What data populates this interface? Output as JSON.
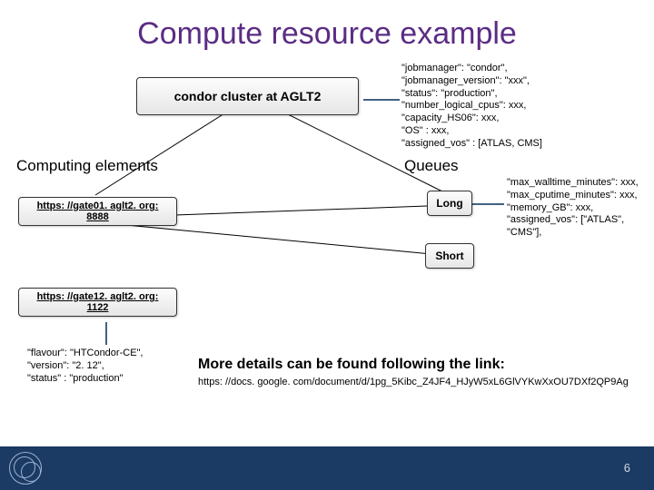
{
  "title": "Compute resource example",
  "cluster_box": "condor cluster at AGLT2",
  "cluster_props": "\"jobmanager\": \"condor\",\n \"jobmanager_version\": \"xxx\",\n \"status\": \"production\",\n \"number_logical_cpus\": xxx,\n \"capacity_HS06\": xxx,\n \"OS\" : xxx,\n \"assigned_vos\" : [ATLAS, CMS]",
  "section_ce": "Computing elements",
  "section_queues": "Queues",
  "ce1": "https: //gate01. aglt2. org: 8888",
  "ce2": "https: //gate12. aglt2. org: 1122",
  "ce_props": "\"flavour\": \"HTCondor-CE\",\n\"version\": \"2. 12\",\n\"status\" : \"production\"",
  "queue_long": "Long",
  "queue_short": "Short",
  "queue_long_props": "\"max_walltime_minutes\": xxx,\n\"max_cputime_minutes\": xxx,\n\"memory_GB\": xxx,\n\"assigned_vos\": [\"ATLAS\", \"CMS\"],",
  "more": "More details can be found following the link:",
  "docs_url": "https: //docs. google. com/document/d/1pg_5Kibc_Z4JF4_HJyW5xL6GlVYKwXxOU7DXf2QP9Ag",
  "page": "6"
}
